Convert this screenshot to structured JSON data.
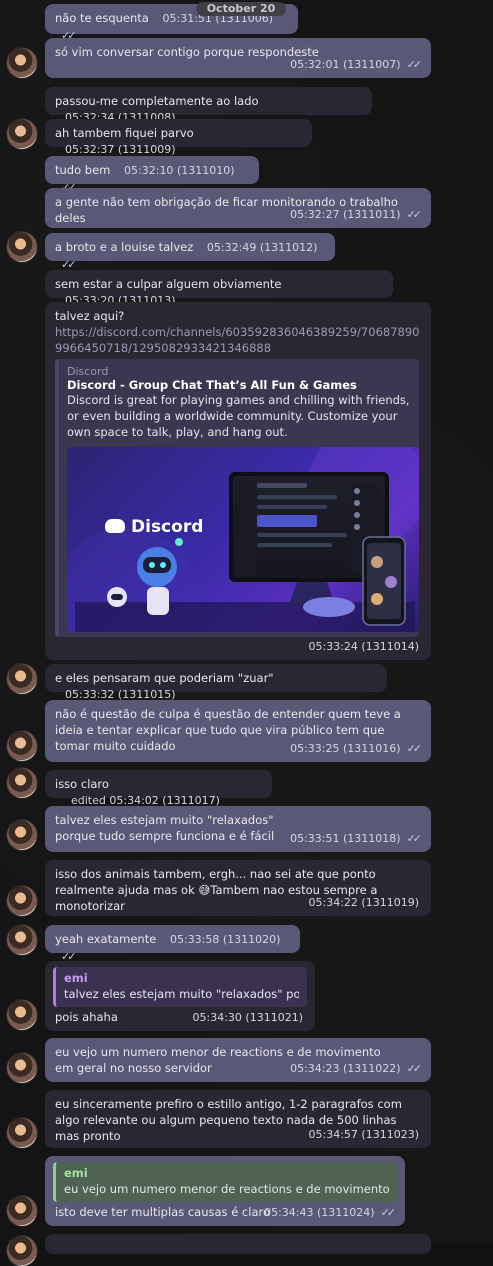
{
  "date_pill": "October 20",
  "messages": [
    {
      "text": "não te esquenta",
      "time": "05:31:51",
      "id": "(1311006)"
    },
    {
      "text": "só vim conversar contigo porque respondeste",
      "time": "05:32:01",
      "id": "(1311007)"
    },
    {
      "text": "passou-me completamente ao lado",
      "time": "05:32:34",
      "id": "(1311008)"
    },
    {
      "text": "ah tambem fiquei parvo",
      "time": "05:32:37",
      "id": "(1311009)"
    },
    {
      "text": "tudo bem",
      "time": "05:32:10",
      "id": "(1311010)"
    },
    {
      "text": "a gente não tem obrigação de ficar monitorando o trabalho deles",
      "time": "05:32:27",
      "id": "(1311011)"
    },
    {
      "text": "a broto e a louise talvez",
      "time": "05:32:49",
      "id": "(1311012)"
    },
    {
      "text": "sem estar a culpar alguem obviamente",
      "time": "05:33:20",
      "id": "(1311013)"
    },
    {
      "text": "talvez aqui?",
      "link": "https://discord.com/channels/603592836046389259/706878909966450718/1295082933421346888",
      "time": "05:33:24",
      "id": "(1311014)"
    },
    {
      "text": "e eles pensaram que poderiam \"zuar\"",
      "time": "05:33:32",
      "id": "(1311015)"
    },
    {
      "text": "não é questão de culpa é questão de entender quem teve a ideia e tentar explicar que tudo que vira público tem que tomar muito cuidado",
      "time": "05:33:25",
      "id": "(1311016)"
    },
    {
      "text": "isso claro",
      "edited": "edited",
      "time": "05:34:02",
      "id": "(1311017)"
    },
    {
      "text": "talvez eles estejam muito \"relaxados\" porque tudo sempre funciona e é fácil",
      "time": "05:33:51",
      "id": "(1311018)"
    },
    {
      "text": "isso dos animais tambem, ergh... nao sei ate que ponto realmente ajuda mas ok",
      "emoji": "😅",
      "text2": "Tambem nao estou sempre a monotorizar",
      "time": "05:34:22",
      "id": "(1311019)"
    },
    {
      "text": "yeah exatamente",
      "time": "05:33:58",
      "id": "(1311020)"
    },
    {
      "quote_name": "emi",
      "quote_text": "talvez eles estejam muito \"relaxados\" por...",
      "text": "pois ahaha",
      "time": "05:34:30",
      "id": "(1311021)"
    },
    {
      "text": "eu vejo um numero menor de reactions e de movimento em geral no nosso servidor",
      "time": "05:34:23",
      "id": "(1311022)"
    },
    {
      "text": "eu sinceramente prefiro o estillo antigo, 1-2 paragrafos com algo relevante ou algum pequeno texto nada de 500 linhas mas pronto",
      "time": "05:34:57",
      "id": "(1311023)"
    },
    {
      "quote_name": "emi",
      "quote_text": "eu vejo um numero menor de reactions e de movimento e...",
      "text": "isto deve ter multiplas causas é claro",
      "time": "05:34:43",
      "id": "(1311024)"
    }
  ],
  "embed": {
    "site": "Discord",
    "title": "Discord - Group Chat That’s All Fun & Games",
    "description": "Discord is great for playing games and chilling with friends, or even building a worldwide community. Customize your own space to talk, play, and hang out.",
    "image_logo": "Discord"
  },
  "colors": {
    "incoming": "#2a2733",
    "outgoing": "#5a5877",
    "quote_purple": "#b07be0",
    "quote_green": "#8fd08a"
  }
}
